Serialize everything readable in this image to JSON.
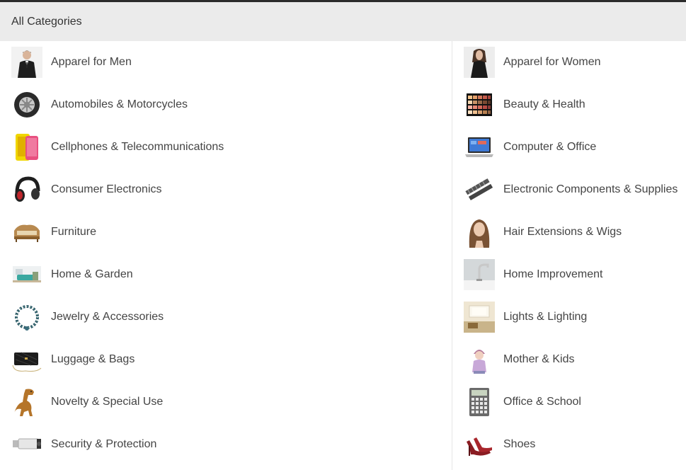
{
  "header": {
    "title": "All Categories"
  },
  "left": [
    {
      "label": "Apparel for Men",
      "icon": "man-suit-icon"
    },
    {
      "label": "Automobiles & Motorcycles",
      "icon": "tire-icon"
    },
    {
      "label": "Cellphones & Telecommunications",
      "icon": "smartphone-icon"
    },
    {
      "label": "Consumer Electronics",
      "icon": "headphones-icon"
    },
    {
      "label": "Furniture",
      "icon": "sofa-icon"
    },
    {
      "label": "Home & Garden",
      "icon": "living-room-icon"
    },
    {
      "label": "Jewelry & Accessories",
      "icon": "necklace-icon"
    },
    {
      "label": "Luggage & Bags",
      "icon": "handbag-icon"
    },
    {
      "label": "Novelty & Special Use",
      "icon": "dinosaur-costume-icon"
    },
    {
      "label": "Security & Protection",
      "icon": "security-camera-icon"
    }
  ],
  "right": [
    {
      "label": "Apparel for Women",
      "icon": "woman-dress-icon"
    },
    {
      "label": "Beauty & Health",
      "icon": "makeup-palette-icon"
    },
    {
      "label": "Computer & Office",
      "icon": "laptop-icon"
    },
    {
      "label": "Electronic Components & Supplies",
      "icon": "electronic-components-icon"
    },
    {
      "label": "Hair Extensions & Wigs",
      "icon": "hair-wig-icon"
    },
    {
      "label": "Home Improvement",
      "icon": "faucet-icon"
    },
    {
      "label": "Lights & Lighting",
      "icon": "ceiling-light-icon"
    },
    {
      "label": "Mother & Kids",
      "icon": "kid-icon"
    },
    {
      "label": "Office & School",
      "icon": "calculator-icon"
    },
    {
      "label": "Shoes",
      "icon": "high-heel-shoe-icon"
    }
  ]
}
